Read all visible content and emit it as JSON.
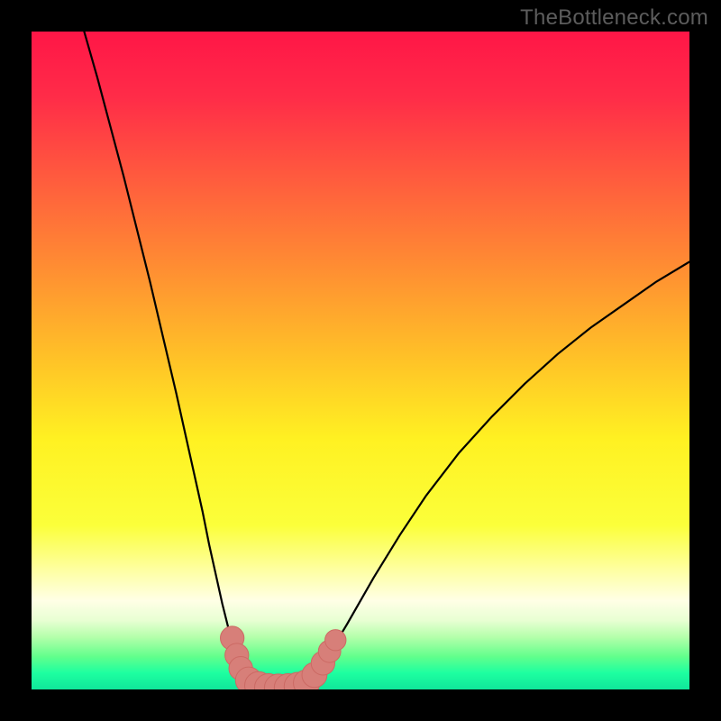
{
  "watermark": "TheBottleneck.com",
  "colors": {
    "frame": "#000000",
    "curve": "#000000",
    "marker_fill": "#d77f79",
    "marker_stroke": "#cc6a64",
    "gradient_stops": [
      {
        "offset": 0.0,
        "color": "#ff1647"
      },
      {
        "offset": 0.1,
        "color": "#ff2c48"
      },
      {
        "offset": 0.22,
        "color": "#ff5a3e"
      },
      {
        "offset": 0.35,
        "color": "#ff8a33"
      },
      {
        "offset": 0.5,
        "color": "#ffc327"
      },
      {
        "offset": 0.62,
        "color": "#fff122"
      },
      {
        "offset": 0.75,
        "color": "#fbff3a"
      },
      {
        "offset": 0.82,
        "color": "#feffa4"
      },
      {
        "offset": 0.865,
        "color": "#ffffe6"
      },
      {
        "offset": 0.895,
        "color": "#e8ffd3"
      },
      {
        "offset": 0.92,
        "color": "#b5ffab"
      },
      {
        "offset": 0.95,
        "color": "#62ff8c"
      },
      {
        "offset": 0.975,
        "color": "#1dffa0"
      },
      {
        "offset": 1.0,
        "color": "#10e69a"
      }
    ]
  },
  "chart_data": {
    "type": "line",
    "title": "",
    "xlabel": "",
    "ylabel": "",
    "xlim": [
      0,
      100
    ],
    "ylim": [
      0,
      100
    ],
    "grid": false,
    "series": [
      {
        "name": "left-branch",
        "x": [
          8,
          10,
          12,
          14,
          16,
          18,
          20,
          22,
          24,
          26,
          27,
          28,
          29,
          30,
          31,
          32,
          33,
          34
        ],
        "y": [
          100,
          93,
          85.5,
          78,
          70,
          62,
          53.5,
          45,
          36,
          27,
          22,
          17.5,
          13,
          9,
          5.5,
          3,
          1.3,
          0.5
        ]
      },
      {
        "name": "valley-floor",
        "x": [
          34,
          36,
          38,
          40,
          41.5
        ],
        "y": [
          0.5,
          0.2,
          0.2,
          0.3,
          0.5
        ]
      },
      {
        "name": "right-branch",
        "x": [
          41.5,
          43,
          45,
          48,
          52,
          56,
          60,
          65,
          70,
          75,
          80,
          85,
          90,
          95,
          100
        ],
        "y": [
          0.5,
          2,
          5,
          10,
          17,
          23.5,
          29.5,
          36,
          41.5,
          46.5,
          51,
          55,
          58.5,
          62,
          65
        ]
      }
    ],
    "markers": {
      "name": "highlight-cluster",
      "points": [
        {
          "x": 30.5,
          "y": 7.8,
          "r": 1.8
        },
        {
          "x": 31.2,
          "y": 5.2,
          "r": 1.8
        },
        {
          "x": 31.8,
          "y": 3.2,
          "r": 1.8
        },
        {
          "x": 33.0,
          "y": 1.4,
          "r": 2.0
        },
        {
          "x": 34.5,
          "y": 0.6,
          "r": 2.1
        },
        {
          "x": 36.0,
          "y": 0.3,
          "r": 2.1
        },
        {
          "x": 37.5,
          "y": 0.25,
          "r": 2.1
        },
        {
          "x": 39.0,
          "y": 0.3,
          "r": 2.1
        },
        {
          "x": 40.5,
          "y": 0.5,
          "r": 2.1
        },
        {
          "x": 41.8,
          "y": 1.0,
          "r": 2.0
        },
        {
          "x": 43.0,
          "y": 2.2,
          "r": 1.9
        },
        {
          "x": 44.3,
          "y": 4.0,
          "r": 1.8
        },
        {
          "x": 45.3,
          "y": 5.8,
          "r": 1.7
        },
        {
          "x": 46.2,
          "y": 7.5,
          "r": 1.6
        }
      ]
    }
  }
}
